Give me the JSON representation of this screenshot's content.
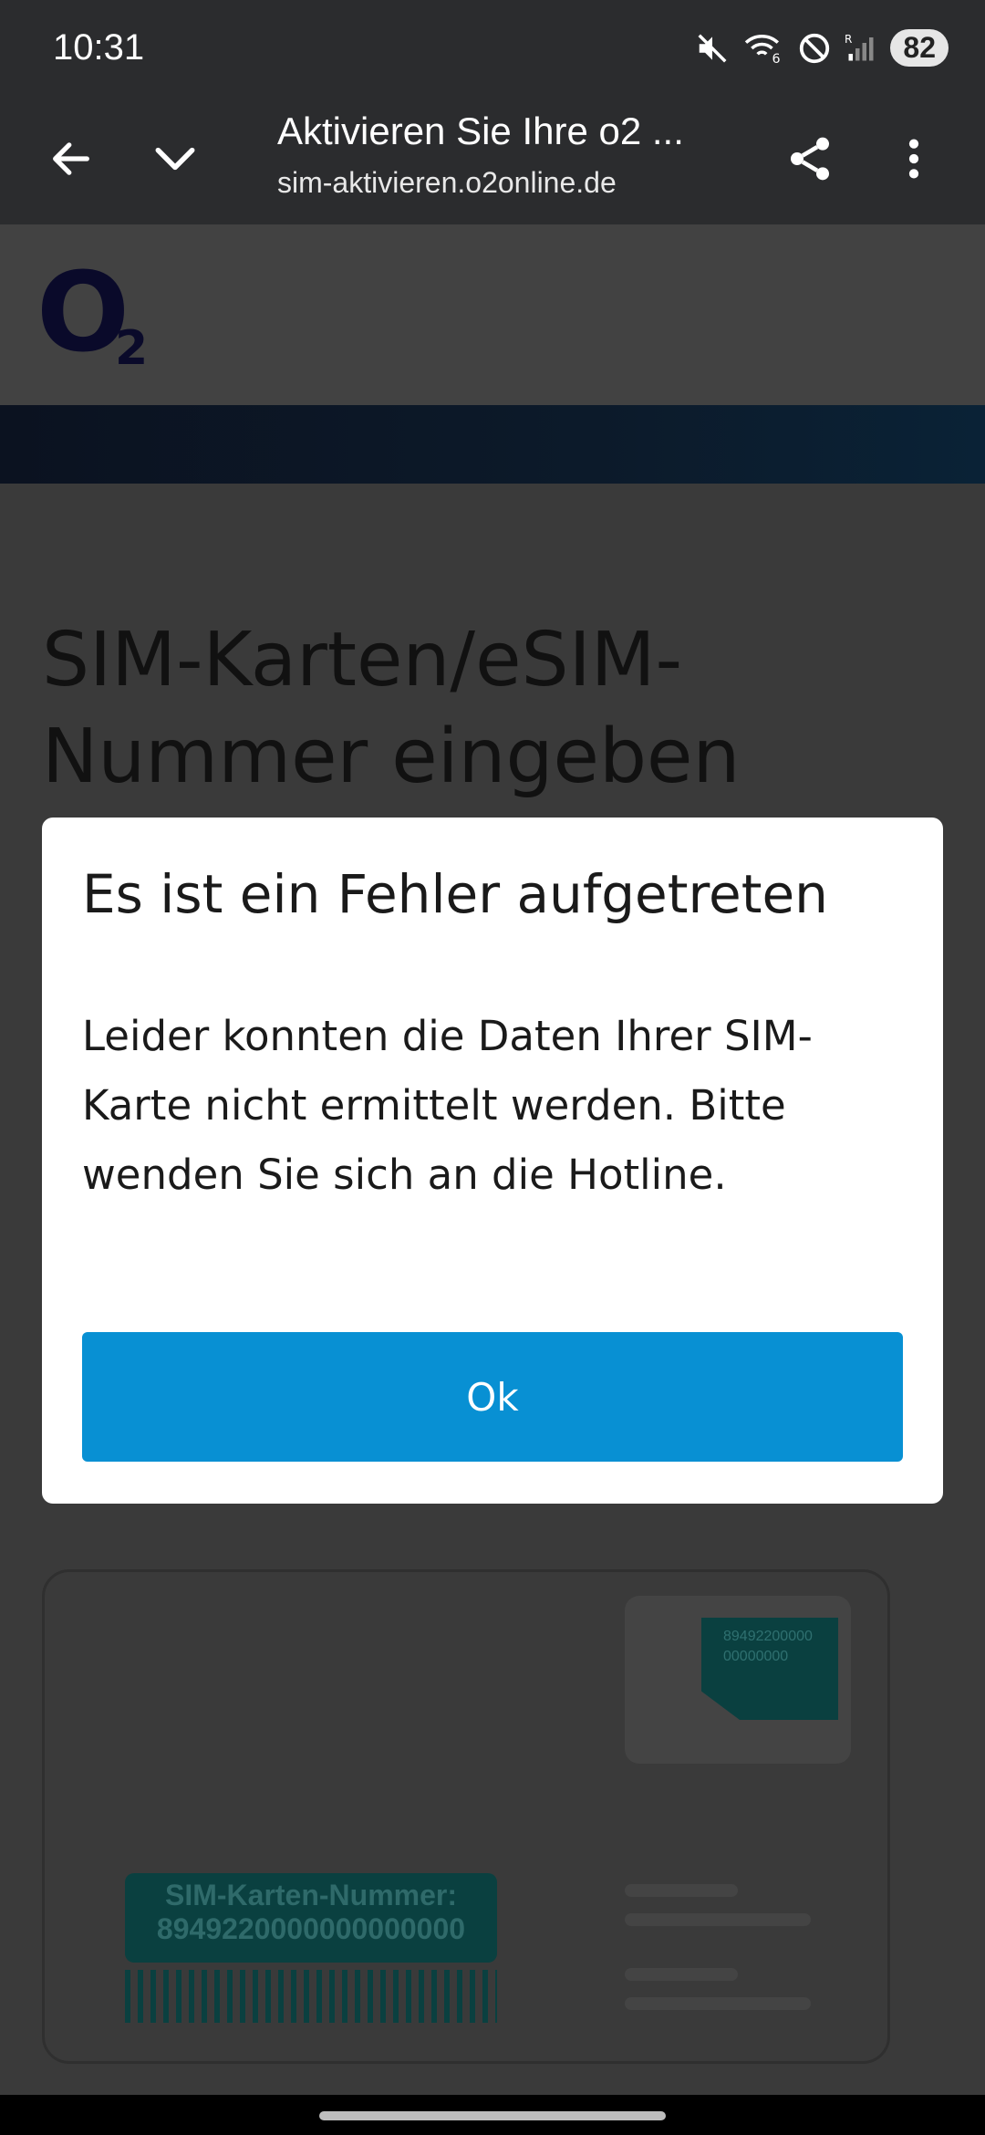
{
  "status_bar": {
    "time": "10:31",
    "battery": "82",
    "icons": [
      "mute-icon",
      "wifi-icon",
      "do-not-disturb-icon",
      "signal-icon"
    ]
  },
  "browser": {
    "page_title": "Aktivieren Sie Ihre o2 ...",
    "url": "sim-aktivieren.o2online.de",
    "icons": [
      "back-arrow-icon",
      "chevron-down-icon",
      "share-icon",
      "more-vert-icon"
    ]
  },
  "page": {
    "logo_letter": "O",
    "logo_subscript": "2",
    "heading": "SIM-Karten/eSIM-Nummer eingeben",
    "sim_illustration": {
      "chip_text_1": "89492200000",
      "chip_text_2": "00000000",
      "number_label": "SIM-Karten-Nummer:",
      "number_value": "8949220000000000000"
    }
  },
  "dialog": {
    "title": "Es ist ein Fehler aufgetreten",
    "message": "Leider konnten die Daten Ihrer SIM-Karte nicht ermittelt werden. Bitte wenden Sie sich an die Hotline.",
    "ok_label": "Ok"
  },
  "colors": {
    "toolbar_bg": "#2b2c2e",
    "button_bg": "#0890d3",
    "page_dimmed_bg": "#3a3a3a"
  }
}
